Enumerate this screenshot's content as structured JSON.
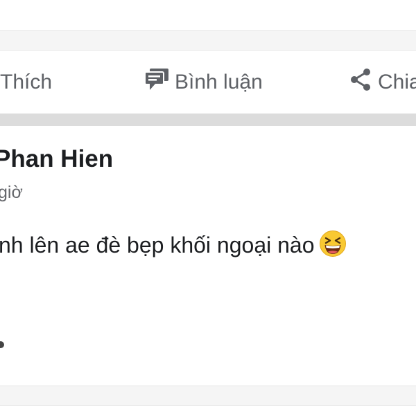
{
  "actions": {
    "like_label": "Thích",
    "comment_label": "Bình luận",
    "share_label": "Chia"
  },
  "post": {
    "author": "Phan Hien",
    "timestamp": "giờ",
    "text": "nh lên ae đè bẹp khối ngoại nào"
  },
  "icons": {
    "comment": "comment-icon",
    "share": "share-icon",
    "emoji": "grinning-squinting-face-emoji",
    "more": "more-dot-icon"
  },
  "colors": {
    "action_text": "#5e6166",
    "author_text": "#1c1e21",
    "meta_text": "#65676b",
    "divider_band": "#dcdcdc"
  }
}
